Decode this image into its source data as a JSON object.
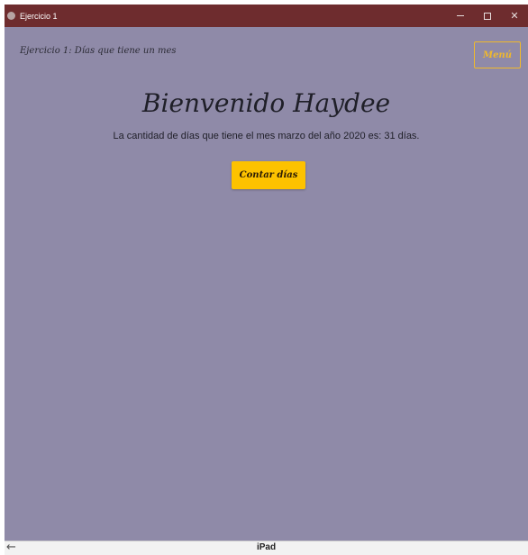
{
  "window": {
    "title": "Ejercicio 1",
    "controls": {
      "minimize": "–",
      "close": "✕"
    }
  },
  "header": {
    "label": "Ejercicio 1: Días que tiene un mes",
    "menu_label": "Menú"
  },
  "main": {
    "welcome": "Bienvenido Haydee",
    "message": "La cantidad de días que tiene el mes marzo del año 2020 es: 31 días.",
    "count_button_label": "Contar días"
  },
  "bottom_bar": {
    "back_glyph": "←",
    "device_label": "iPad"
  },
  "icons": {
    "app_icon": "app-icon",
    "back": "back-arrow-icon"
  },
  "colors": {
    "titlebar": "#6e2c2e",
    "background": "#8f8aa8",
    "accent": "#fdc200",
    "menu_outline": "#f0b92c"
  }
}
